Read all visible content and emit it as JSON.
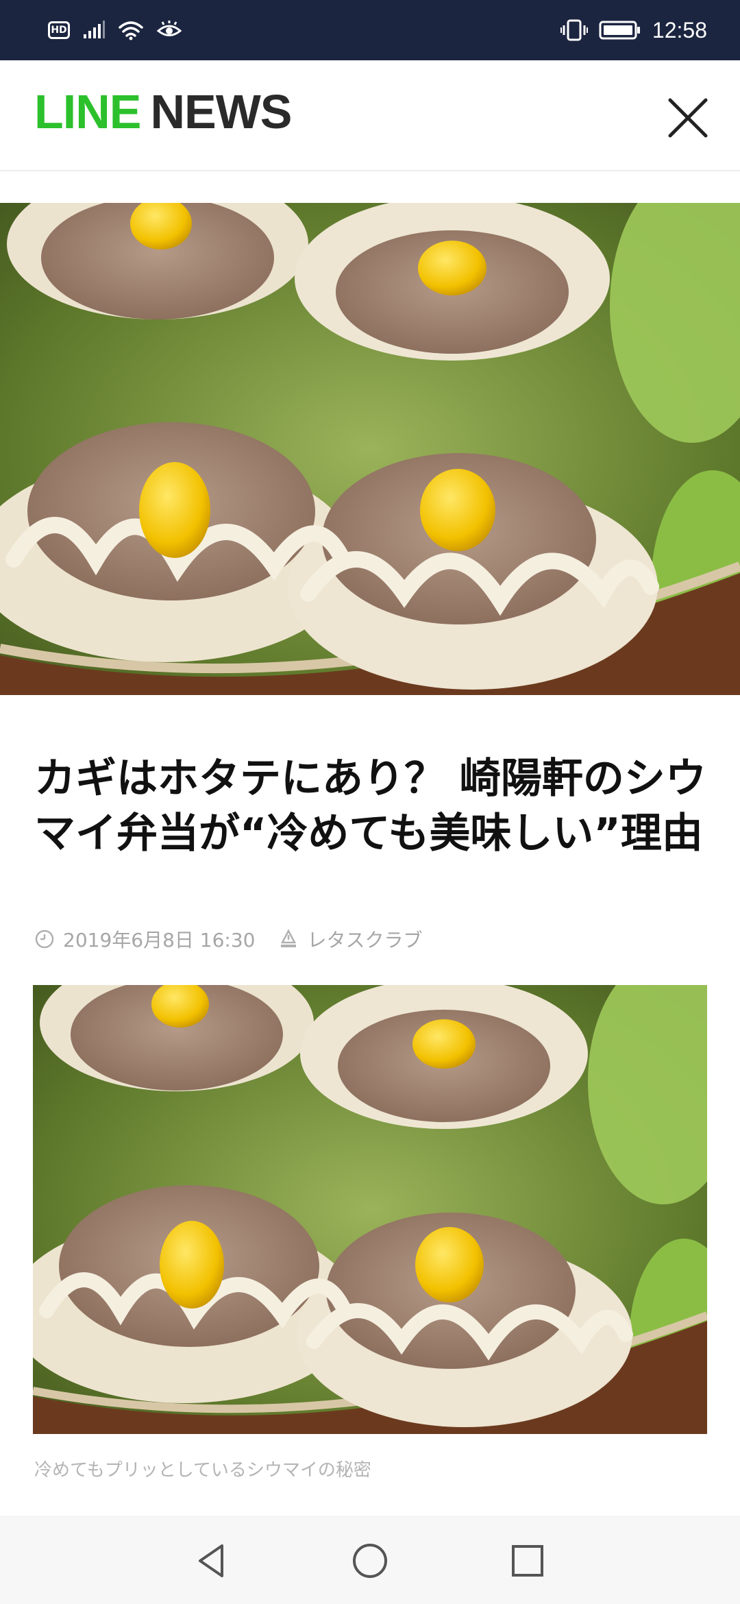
{
  "status_bar": {
    "hd_badge": "HD",
    "time": "12:58"
  },
  "header": {
    "logo_line": "LINE",
    "logo_news": "NEWS",
    "close_icon": "close-icon"
  },
  "article": {
    "title": "カギはホタテにあり？ 崎陽軒のシウマイ弁当が“冷めても美味しい”理由",
    "date": "2019年6月8日 16:30",
    "source": "レタスクラブ",
    "image_caption": "冷めてもプリッとしているシウマイの秘密"
  },
  "nav": {
    "back_icon": "back-triangle-icon",
    "home_icon": "home-circle-icon",
    "recent_icon": "recent-square-icon"
  },
  "colors": {
    "status_bar_bg": "#1c2540",
    "line_green": "#2cc02c",
    "logo_dark": "#2a2a2a",
    "meta_gray": "#a6a6a6"
  }
}
